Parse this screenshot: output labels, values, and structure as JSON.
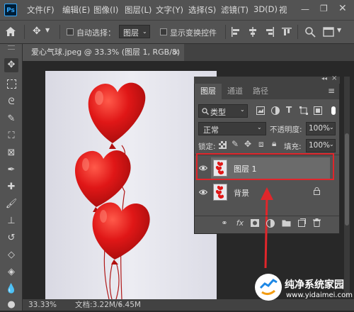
{
  "menubar": {
    "logo": "Ps",
    "items": [
      "文件(F)",
      "编辑(E)",
      "图像(I)",
      "图层(L)",
      "文字(Y)",
      "选择(S)",
      "滤镜(T)",
      "3D(D)",
      "视"
    ]
  },
  "options": {
    "auto_select_label": "自动选择：",
    "auto_select_value": "图层",
    "show_transform_label": "显示变换控件"
  },
  "document": {
    "tab_title": "爱心气球.jpeg @ 33.3% (图层 1, RGB/8) *",
    "zoom": "33.33%",
    "doc_size": "文档:3.22M/6.45M"
  },
  "layers_panel": {
    "tabs": [
      "图层",
      "通道",
      "路径"
    ],
    "filter_label": "类型",
    "blend_mode": "正常",
    "opacity_label": "不透明度:",
    "opacity_value": "100%",
    "lock_label": "锁定:",
    "fill_label": "填充:",
    "fill_value": "100%",
    "layers": [
      {
        "name": "图层 1",
        "selected": true
      },
      {
        "name": "背景",
        "locked": true
      }
    ],
    "footer_icons": [
      "link-icon",
      "fx-icon",
      "mask-icon",
      "adjustment-icon",
      "group-icon",
      "new-layer-icon",
      "delete-icon"
    ]
  },
  "watermark": {
    "title": "纯净系统家园",
    "url": "www.yidaimei.com"
  },
  "colors": {
    "highlight_red": "#e0262b",
    "selected_row": "#6b6b6b",
    "balloon_red": "#e01717"
  }
}
